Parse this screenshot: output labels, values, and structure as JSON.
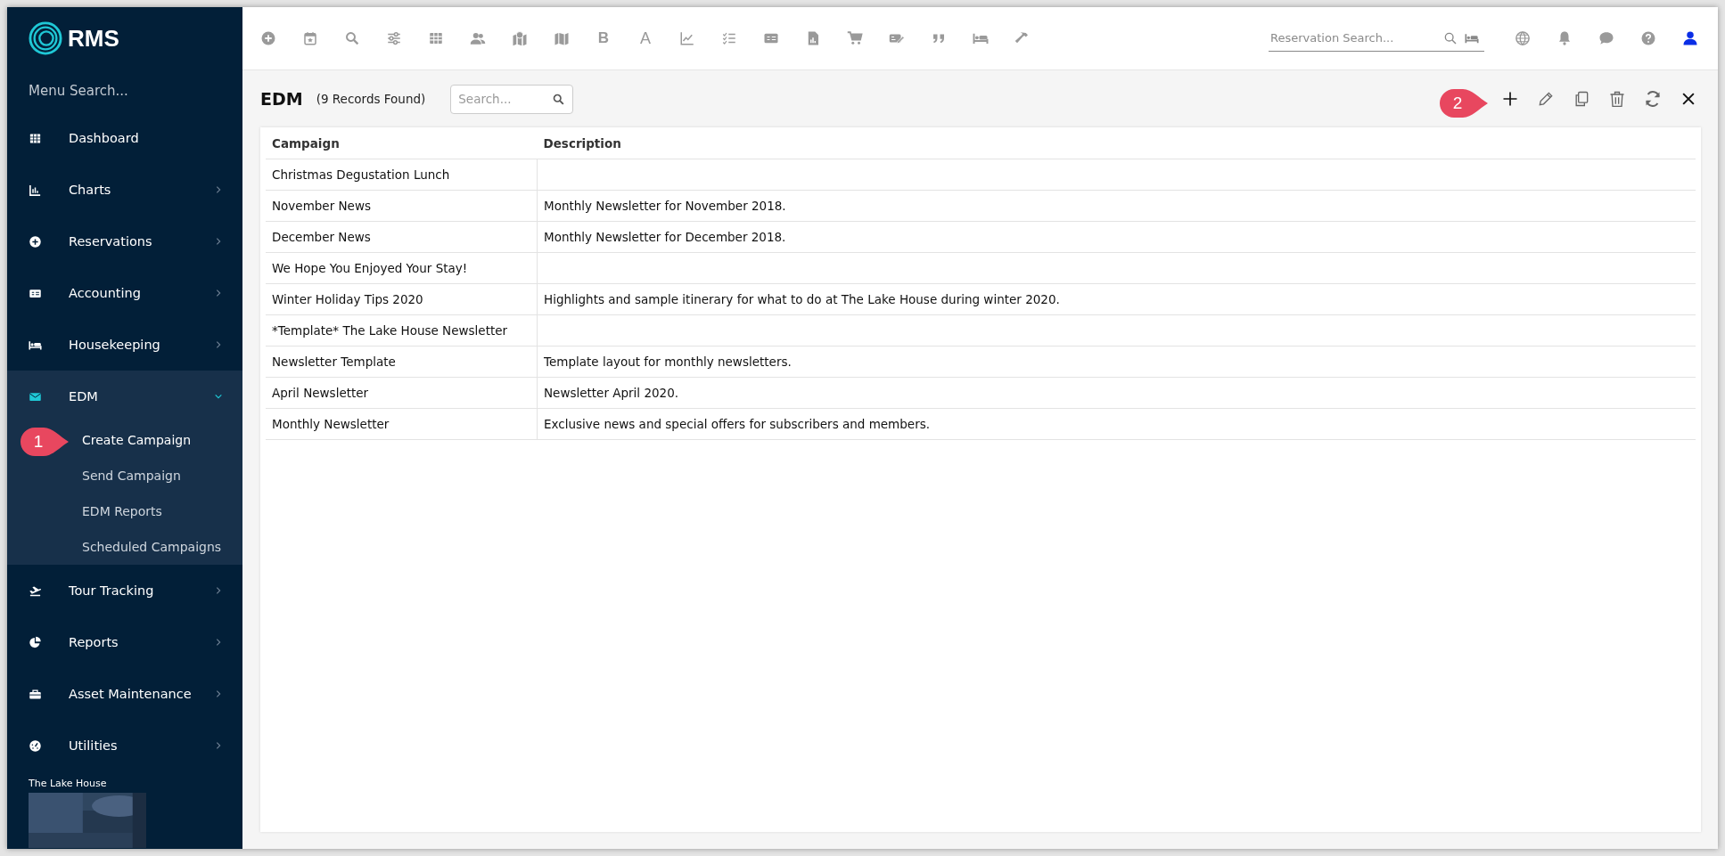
{
  "logo": {
    "text": "RMS"
  },
  "sidebar": {
    "search_placeholder": "Menu Search...",
    "items": [
      {
        "label": "Dashboard"
      },
      {
        "label": "Charts",
        "expanded": false
      },
      {
        "label": "Reservations",
        "expanded": false
      },
      {
        "label": "Accounting",
        "expanded": false
      },
      {
        "label": "Housekeeping",
        "expanded": false
      },
      {
        "label": "EDM",
        "expanded": true,
        "children": [
          {
            "label": "Create Campaign",
            "selected": true
          },
          {
            "label": "Send Campaign",
            "selected": false
          },
          {
            "label": "EDM Reports",
            "selected": false
          },
          {
            "label": "Scheduled Campaigns",
            "selected": false
          }
        ]
      },
      {
        "label": "Tour Tracking",
        "expanded": false
      },
      {
        "label": "Reports",
        "expanded": false
      },
      {
        "label": "Asset Maintenance",
        "expanded": false
      },
      {
        "label": "Utilities",
        "expanded": false
      }
    ],
    "property_name": "The Lake House"
  },
  "toolbar_letters": [
    "B",
    "A"
  ],
  "reservation_search": {
    "placeholder": "Reservation Search..."
  },
  "page": {
    "title": "EDM",
    "record_count": "(9 Records Found)",
    "search_placeholder": "Search..."
  },
  "table": {
    "columns": [
      "Campaign",
      "Description"
    ],
    "rows": [
      [
        "Christmas Degustation Lunch",
        ""
      ],
      [
        "November News",
        "Monthly Newsletter for November 2018."
      ],
      [
        "December News",
        "Monthly Newsletter for December 2018."
      ],
      [
        "We Hope You Enjoyed Your Stay!",
        ""
      ],
      [
        "Winter Holiday Tips 2020",
        "Highlights and sample itinerary for what to do at The Lake House during winter 2020."
      ],
      [
        "*Template* The Lake House Newsletter",
        ""
      ],
      [
        "Newsletter Template",
        "Template layout for monthly newsletters."
      ],
      [
        "April Newsletter",
        "Newsletter April 2020."
      ],
      [
        "Monthly Newsletter",
        "Exclusive news and special offers for subscribers and members."
      ]
    ]
  },
  "callouts": [
    "1",
    "2"
  ]
}
